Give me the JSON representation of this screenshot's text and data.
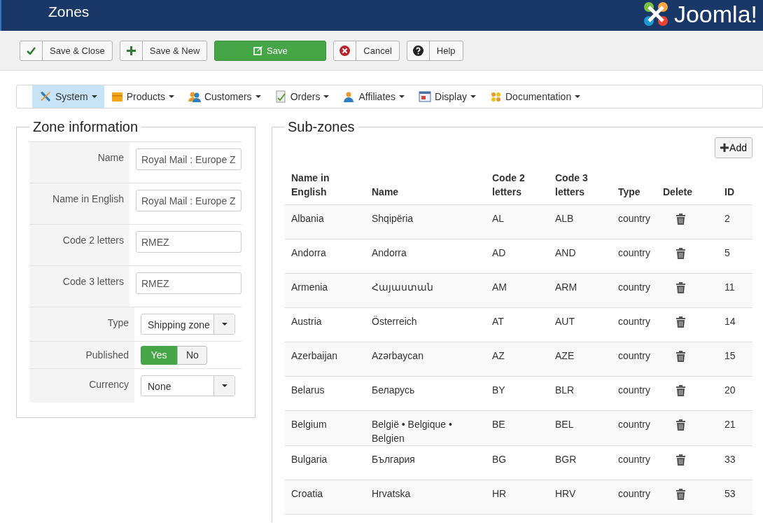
{
  "header": {
    "title": "Zones",
    "logo_text": "Joomla!"
  },
  "toolbar": [
    {
      "label": "Save & Close",
      "kind": "check"
    },
    {
      "label": "Save & New",
      "kind": "plus"
    },
    {
      "label": "Save",
      "kind": "primary"
    },
    {
      "label": "Cancel",
      "kind": "cancel"
    },
    {
      "label": "Help",
      "kind": "help"
    }
  ],
  "menu": [
    {
      "label": "System",
      "selected": true
    },
    {
      "label": "Products",
      "selected": false
    },
    {
      "label": "Customers",
      "selected": false
    },
    {
      "label": "Orders",
      "selected": false
    },
    {
      "label": "Affiliates",
      "selected": false
    },
    {
      "label": "Display",
      "selected": false
    },
    {
      "label": "Documentation",
      "selected": false
    }
  ],
  "zone_information": {
    "title": "Zone information",
    "fields": [
      {
        "label": "Name",
        "kind": "text",
        "value": "Royal Mail : Europe Z"
      },
      {
        "label": "Name in English",
        "kind": "text",
        "value": "Royal Mail : Europe Z"
      },
      {
        "label": "Code 2 letters",
        "kind": "text",
        "value": "RMEZ"
      },
      {
        "label": "Code 3 letters",
        "kind": "text",
        "value": "RMEZ"
      },
      {
        "label": "Type",
        "kind": "select",
        "value": "Shipping zone"
      },
      {
        "label": "Published",
        "kind": "toggle",
        "options": [
          {
            "label": "Yes",
            "selected": true
          },
          {
            "label": "No",
            "selected": false
          }
        ]
      },
      {
        "label": "Currency",
        "kind": "select",
        "value": "None"
      }
    ]
  },
  "sub_zones": {
    "title": "Sub-zones",
    "add_button": "Add",
    "columns": [
      "Name in English",
      "Name",
      "Code 2 letters",
      "Code 3 letters",
      "Type",
      "Delete",
      "ID"
    ],
    "rows": [
      [
        "Albania",
        "Shqipëria",
        "AL",
        "ALB",
        "country",
        "2"
      ],
      [
        "Andorra",
        "Andorra",
        "AD",
        "AND",
        "country",
        "5"
      ],
      [
        "Armenia",
        "Հայաստան",
        "AM",
        "ARM",
        "country",
        "11"
      ],
      [
        "Austria",
        "Österreich",
        "AT",
        "AUT",
        "country",
        "14"
      ],
      [
        "Azerbaijan",
        "Azərbaycan",
        "AZ",
        "AZE",
        "country",
        "15"
      ],
      [
        "Belarus",
        "Беларусь",
        "BY",
        "BLR",
        "country",
        "20"
      ],
      [
        "Belgium",
        "België • Belgique • Belgien",
        "BE",
        "BEL",
        "country",
        "21"
      ],
      [
        "Bulgaria",
        "България",
        "BG",
        "BGR",
        "country",
        "33"
      ],
      [
        "Croatia",
        "Hrvatska",
        "HR",
        "HRV",
        "country",
        "53"
      ]
    ]
  }
}
